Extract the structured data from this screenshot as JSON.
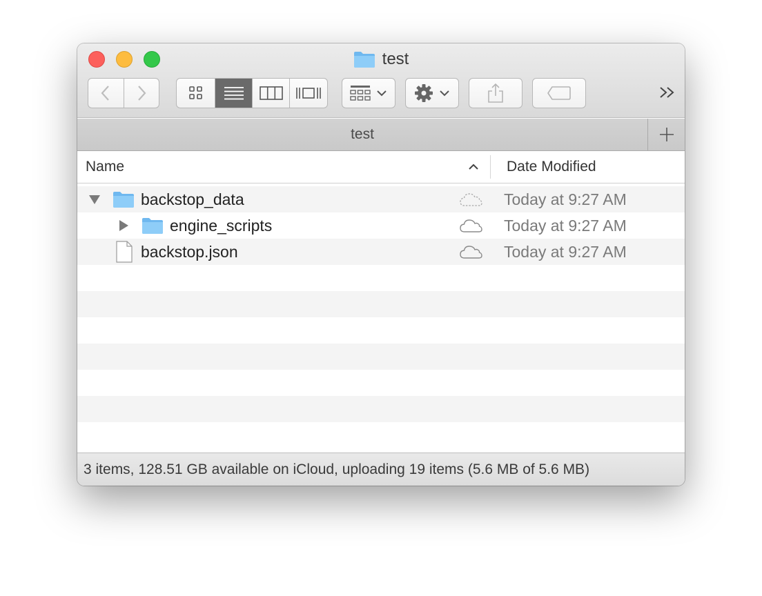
{
  "window": {
    "title": "test",
    "title_icon": "folder-icon"
  },
  "toolbar": {
    "back_icon": "chevron-left-icon",
    "forward_icon": "chevron-right-icon",
    "view_modes": [
      {
        "name": "icon-view",
        "icon": "grid-icon",
        "active": false
      },
      {
        "name": "list-view",
        "icon": "list-icon",
        "active": true
      },
      {
        "name": "column-view",
        "icon": "columns-icon",
        "active": false
      },
      {
        "name": "cover-flow-view",
        "icon": "coverflow-icon",
        "active": false
      }
    ],
    "arrange_icon": "arrange-grid-icon",
    "action_icon": "gear-icon",
    "share_icon": "share-icon",
    "tag_icon": "tag-icon",
    "more_icon": "double-chevron-right-icon"
  },
  "tabbar": {
    "tab_label": "test",
    "add_tab_label": "+"
  },
  "columns": {
    "name": "Name",
    "date_modified": "Date Modified",
    "sort": "ascending"
  },
  "files": [
    {
      "name": "backstop_data",
      "type": "folder",
      "expanded": true,
      "indent": 0,
      "cloud_status": "uploading",
      "date": "Today at 9:27 AM"
    },
    {
      "name": "engine_scripts",
      "type": "folder",
      "expanded": false,
      "indent": 1,
      "cloud_status": "uploaded",
      "date": "Today at 9:27 AM"
    },
    {
      "name": "backstop.json",
      "type": "file",
      "indent": 0,
      "cloud_status": "uploaded",
      "date": "Today at 9:27 AM"
    }
  ],
  "status": {
    "text": "3 items, 128.51 GB available on iCloud, uploading 19 items (5.6 MB of 5.6 MB)"
  },
  "colors": {
    "close": "#fc605c",
    "minimize": "#fdbc40",
    "maximize": "#34c84a",
    "folder_blue": "#7ec4f5",
    "active_segment": "#6a6a6a"
  }
}
